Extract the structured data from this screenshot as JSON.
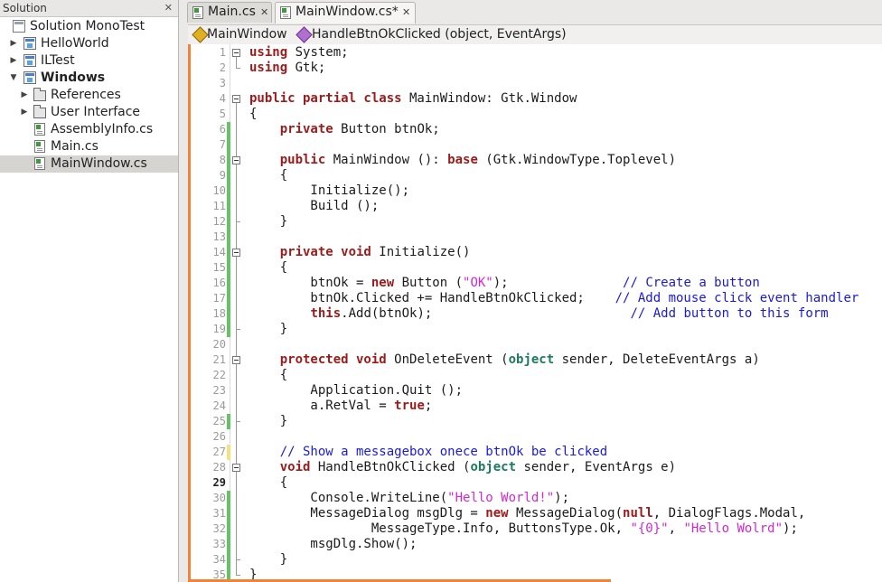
{
  "solution_pane": {
    "header": "Solution",
    "close_glyph": "✕",
    "items": [
      {
        "label": "Solution MonoTest",
        "icon": "solution-icon",
        "bold": false
      },
      {
        "label": "HelloWorld",
        "icon": "project-icon",
        "bold": false
      },
      {
        "label": "ILTest",
        "icon": "project-icon",
        "bold": false
      },
      {
        "label": "Windows",
        "icon": "project-icon",
        "bold": true
      },
      {
        "label": "References",
        "icon": "folder-icon",
        "bold": false
      },
      {
        "label": "User Interface",
        "icon": "folder-icon",
        "bold": false
      },
      {
        "label": "AssemblyInfo.cs",
        "icon": "cs-file-icon",
        "bold": false
      },
      {
        "label": "Main.cs",
        "icon": "cs-file-icon",
        "bold": false
      },
      {
        "label": "MainWindow.cs",
        "icon": "cs-file-icon",
        "bold": false,
        "selected": true
      }
    ]
  },
  "tabs": [
    {
      "label": "Main.cs",
      "close": "✕",
      "active": false
    },
    {
      "label": "MainWindow.cs*",
      "close": "✕",
      "active": true
    }
  ],
  "breadcrumb": {
    "class_name": "MainWindow",
    "method": "HandleBtnOkClicked (object, EventArgs)"
  },
  "code": {
    "line_numbers": [
      "1",
      "2",
      "3",
      "4",
      "5",
      "6",
      "7",
      "8",
      "9",
      "10",
      "11",
      "12",
      "13",
      "14",
      "15",
      "16",
      "17",
      "18",
      "19",
      "20",
      "21",
      "22",
      "23",
      "24",
      "25",
      "26",
      "27",
      "28",
      "29",
      "30",
      "31",
      "32",
      "33",
      "34",
      "35"
    ],
    "current_line": "29",
    "colors": {
      "keyword": "#9c1a1a",
      "type": "#1d7a5a",
      "string": "#d128d1",
      "comment": "#1a1ad6",
      "changed_saved": "#62c462",
      "changed_unsaved": "#f5e27a"
    },
    "lines": [
      [
        {
          "t": "using",
          "c": "kw"
        },
        {
          "t": " System;"
        }
      ],
      [
        {
          "t": "using",
          "c": "kw"
        },
        {
          "t": " Gtk;"
        }
      ],
      [],
      [
        {
          "t": "public partial class",
          "c": "kw"
        },
        {
          "t": " MainWindow: Gtk.Window"
        }
      ],
      [
        {
          "t": "{"
        }
      ],
      [
        {
          "t": "    "
        },
        {
          "t": "private",
          "c": "kw"
        },
        {
          "t": " Button btnOk;"
        }
      ],
      [],
      [
        {
          "t": "    "
        },
        {
          "t": "public",
          "c": "kw"
        },
        {
          "t": " MainWindow (): "
        },
        {
          "t": "base",
          "c": "kw"
        },
        {
          "t": " (Gtk.WindowType.Toplevel)"
        }
      ],
      [
        {
          "t": "    {"
        }
      ],
      [
        {
          "t": "        Initialize();"
        }
      ],
      [
        {
          "t": "        Build ();"
        }
      ],
      [
        {
          "t": "    }"
        }
      ],
      [],
      [
        {
          "t": "    "
        },
        {
          "t": "private void",
          "c": "kw"
        },
        {
          "t": " Initialize()"
        }
      ],
      [
        {
          "t": "    {"
        }
      ],
      [
        {
          "t": "        btnOk = "
        },
        {
          "t": "new",
          "c": "kw"
        },
        {
          "t": " Button ("
        },
        {
          "t": "\"OK\"",
          "c": "str"
        },
        {
          "t": ");               "
        },
        {
          "t": "// Create a button",
          "c": "cm"
        }
      ],
      [
        {
          "t": "        btnOk.Clicked += HandleBtnOkClicked;    "
        },
        {
          "t": "// Add mouse click event handler",
          "c": "cm"
        }
      ],
      [
        {
          "t": "        "
        },
        {
          "t": "this",
          "c": "kw"
        },
        {
          "t": ".Add(btnOk);                          "
        },
        {
          "t": "// Add button to this form",
          "c": "cm"
        }
      ],
      [
        {
          "t": "    }"
        }
      ],
      [],
      [
        {
          "t": "    "
        },
        {
          "t": "protected void",
          "c": "kw"
        },
        {
          "t": " OnDeleteEvent ("
        },
        {
          "t": "object",
          "c": "ty"
        },
        {
          "t": " sender, DeleteEventArgs a)"
        }
      ],
      [
        {
          "t": "    {"
        }
      ],
      [
        {
          "t": "        Application.Quit ();"
        }
      ],
      [
        {
          "t": "        a.RetVal = "
        },
        {
          "t": "true",
          "c": "kw"
        },
        {
          "t": ";"
        }
      ],
      [
        {
          "t": "    }"
        }
      ],
      [],
      [
        {
          "t": "    "
        },
        {
          "t": "// Show a messagebox onece btnOk be clicked",
          "c": "cm"
        }
      ],
      [
        {
          "t": "    "
        },
        {
          "t": "void",
          "c": "kw"
        },
        {
          "t": " HandleBtnOkClicked ("
        },
        {
          "t": "object",
          "c": "ty"
        },
        {
          "t": " sender, EventArgs e)"
        }
      ],
      [
        {
          "t": "    {"
        }
      ],
      [
        {
          "t": "        Console.WriteLine("
        },
        {
          "t": "\"Hello World!\"",
          "c": "str"
        },
        {
          "t": ");"
        }
      ],
      [
        {
          "t": "        MessageDialog msgDlg = "
        },
        {
          "t": "new",
          "c": "kw"
        },
        {
          "t": " MessageDialog("
        },
        {
          "t": "null",
          "c": "kw"
        },
        {
          "t": ", DialogFlags.Modal,"
        }
      ],
      [
        {
          "t": "                MessageType.Info, ButtonsType.Ok, "
        },
        {
          "t": "\"{0}\"",
          "c": "str"
        },
        {
          "t": ", "
        },
        {
          "t": "\"Hello Wolrd\"",
          "c": "str"
        },
        {
          "t": ");"
        }
      ],
      [
        {
          "t": "        msgDlg.Show();"
        }
      ],
      [
        {
          "t": "    }"
        }
      ],
      [
        {
          "t": "}"
        }
      ]
    ]
  }
}
